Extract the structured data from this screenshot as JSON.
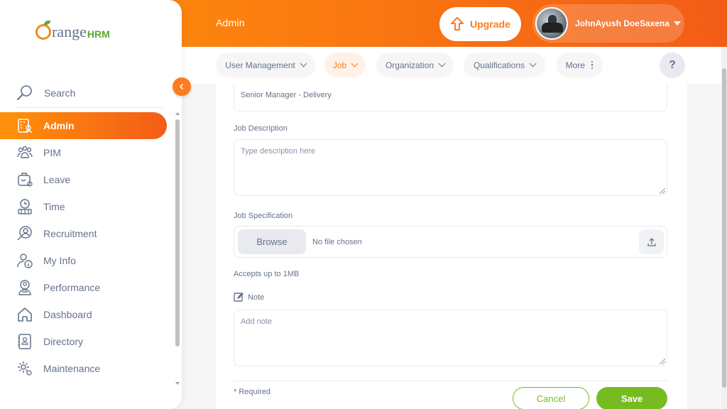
{
  "header": {
    "module_title": "Admin",
    "upgrade_label": "Upgrade",
    "user_name": "JohnAyush DoeSaxena",
    "gradient_start": "#ff920b",
    "gradient_end": "#f35c17"
  },
  "tabs": [
    {
      "label": "User Management",
      "icon": "chevron-down-icon"
    },
    {
      "label": "Job",
      "icon": "chevron-down-icon",
      "active": true
    },
    {
      "label": "Organization",
      "icon": "chevron-down-icon"
    },
    {
      "label": "Qualifications",
      "icon": "chevron-down-icon"
    },
    {
      "label": "More",
      "icon": "more-vertical-icon"
    }
  ],
  "help_label": "?",
  "sidebar": {
    "brand_name": "range",
    "brand_suffix": "HRM",
    "search_label": "Search",
    "items": [
      {
        "label": "Admin",
        "icon": "admin-icon",
        "active": true
      },
      {
        "label": "PIM",
        "icon": "pim-icon"
      },
      {
        "label": "Leave",
        "icon": "leave-icon"
      },
      {
        "label": "Time",
        "icon": "time-icon"
      },
      {
        "label": "Recruitment",
        "icon": "recruitment-icon"
      },
      {
        "label": "My Info",
        "icon": "my-info-icon"
      },
      {
        "label": "Performance",
        "icon": "performance-icon"
      },
      {
        "label": "Dashboard",
        "icon": "dashboard-icon"
      },
      {
        "label": "Directory",
        "icon": "directory-icon"
      },
      {
        "label": "Maintenance",
        "icon": "maintenance-icon"
      }
    ]
  },
  "form": {
    "job_title_value": "Senior Manager - Delivery",
    "job_description_label": "Job Description",
    "job_description_placeholder": "Type description here",
    "job_specification_label": "Job Specification",
    "browse_label": "Browse",
    "no_file_text": "No file chosen",
    "file_hint": "Accepts up to 1MB",
    "note_label": "Note",
    "note_placeholder": "Add note",
    "required_text": "* Required",
    "cancel_label": "Cancel",
    "save_label": "Save"
  },
  "colors": {
    "accent": "#ff7b1d",
    "primary_green": "#76bc21",
    "text": "#64728c"
  }
}
